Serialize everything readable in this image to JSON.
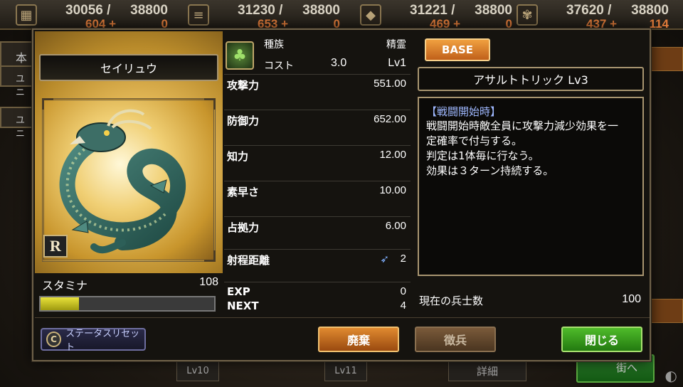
{
  "resources": [
    {
      "icon": "stone-icon",
      "current": "30056 /",
      "max": "38800",
      "income": "604 +",
      "income2": "0"
    },
    {
      "icon": "wood-icon",
      "current": "31230 /",
      "max": "38800",
      "income": "653 +",
      "income2": "0"
    },
    {
      "icon": "iron-icon",
      "current": "31221 /",
      "max": "38800",
      "income": "469 +",
      "income2": "0"
    },
    {
      "icon": "wheat-icon",
      "current": "37620 /",
      "max": "38800",
      "income": "437 +",
      "income2": "114"
    }
  ],
  "background": {
    "tab1": "本",
    "tab2": "ユニ",
    "tab3": "ユニ",
    "bottom_left": "Lv10",
    "bottom_mid": "Lv11",
    "bottom_right": "詳細",
    "go_town": "街へ"
  },
  "card": {
    "name": "セイリュウ",
    "rarity": "R",
    "stamina_label": "スタミナ",
    "stamina_value": "108",
    "stamina_fill_percent": 22
  },
  "stats": {
    "race_label": "種族",
    "race_value": "精霊",
    "cost_label": "コスト",
    "cost_value": "3.0",
    "level_value": "Lv1",
    "rows": [
      {
        "label": "攻撃力",
        "value": "551.00"
      },
      {
        "label": "防御力",
        "value": "652.00"
      },
      {
        "label": "知力",
        "value": "12.00"
      },
      {
        "label": "素早さ",
        "value": "10.00"
      },
      {
        "label": "占拠力",
        "value": "6.00"
      }
    ],
    "range_label": "射程距離",
    "range_value": "2",
    "exp_label": "EXP",
    "exp_value": "0",
    "next_label": "NEXT",
    "next_value": "4"
  },
  "skill": {
    "base_label": "BASE",
    "name": "アサルトトリック Lv3",
    "trigger": "【戦闘開始時】",
    "lines": [
      "戦闘開始時敵全員に攻撃力減少効果を一",
      "定確率で付与する。",
      "判定は1体毎に行なう。",
      "効果は３ターン持続する。"
    ],
    "soldiers_label": "現在の兵士数",
    "soldiers_value": "100"
  },
  "buttons": {
    "reset": "ステータスリセット",
    "reset_icon": "C",
    "discard": "廃棄",
    "recruit": "徴兵",
    "close": "閉じる"
  },
  "colors": {
    "discard": "#e08a30",
    "close": "#4fbb2a",
    "skill_trigger": "#9fb8ff",
    "stamina_fill": "#e8e23a"
  }
}
